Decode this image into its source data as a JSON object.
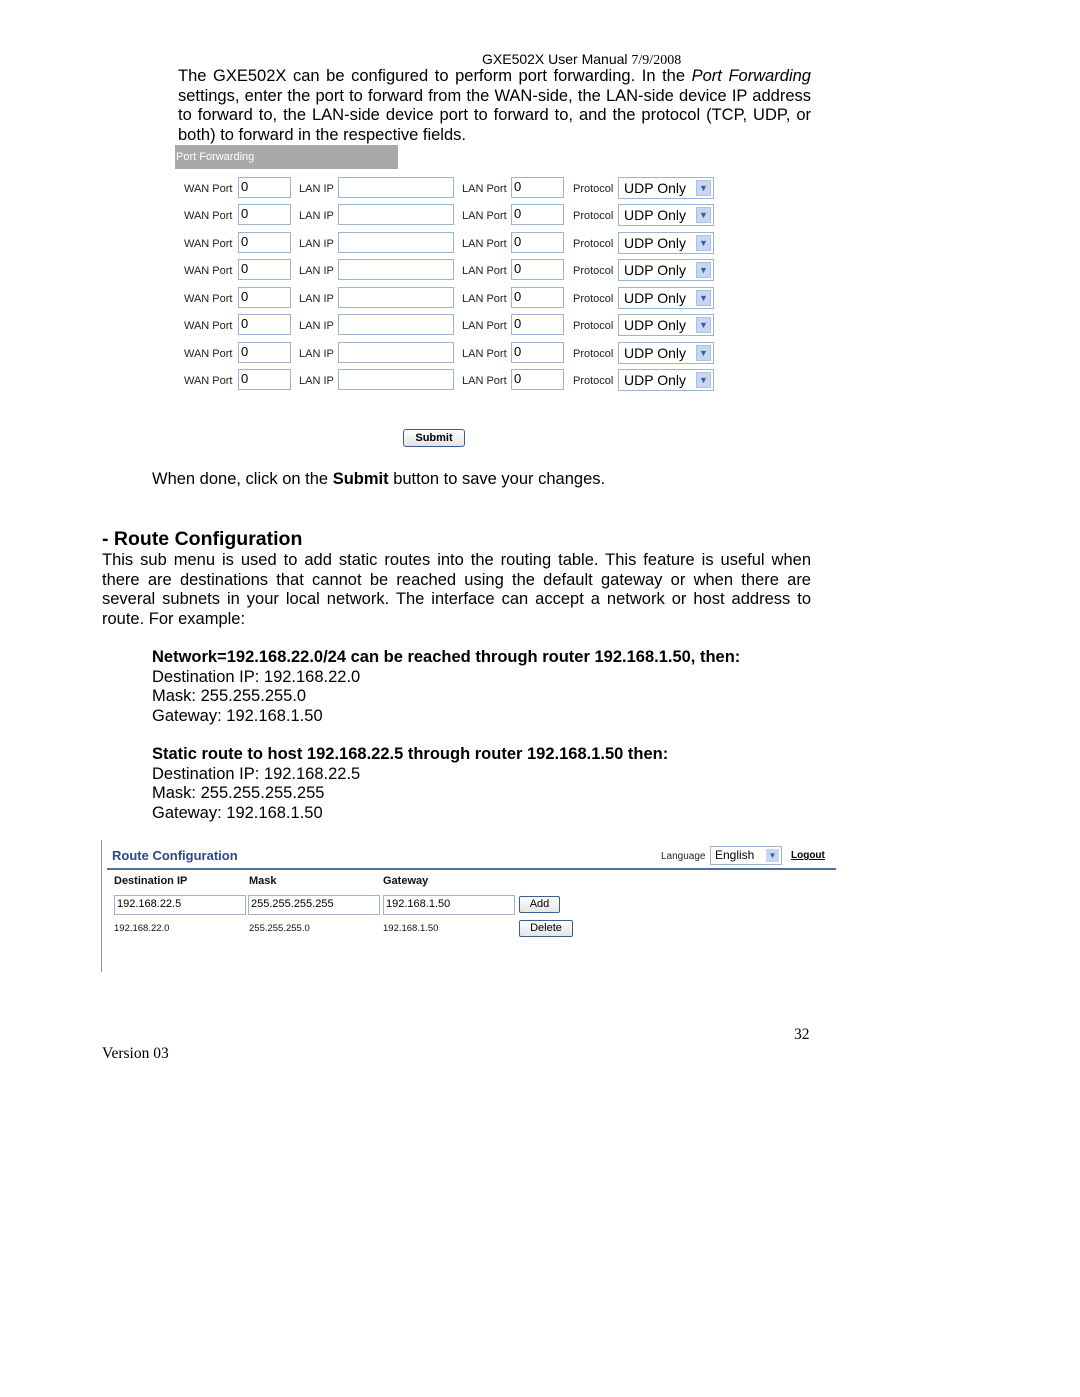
{
  "header": {
    "title": "GXE502X User Manual",
    "date": "7/9/2008"
  },
  "intro": {
    "before_italic": "The GXE502X can be configured to perform port forwarding. In the ",
    "italic": "Port Forwarding",
    "after_italic": " settings, enter the port to forward from the WAN-side, the LAN-side device IP address to forward to, the LAN-side device port to forward to, and the protocol (TCP, UDP, or both) to forward in the respective fields."
  },
  "port_forwarding": {
    "title": "Port Forwarding",
    "labels": {
      "wan_port": "WAN Port",
      "lan_ip": "LAN IP",
      "lan_port": "LAN Port",
      "protocol": "Protocol"
    },
    "rows": [
      {
        "wan_port": "0",
        "lan_ip": "",
        "lan_port": "0",
        "protocol": "UDP Only"
      },
      {
        "wan_port": "0",
        "lan_ip": "",
        "lan_port": "0",
        "protocol": "UDP Only"
      },
      {
        "wan_port": "0",
        "lan_ip": "",
        "lan_port": "0",
        "protocol": "UDP Only"
      },
      {
        "wan_port": "0",
        "lan_ip": "",
        "lan_port": "0",
        "protocol": "UDP Only"
      },
      {
        "wan_port": "0",
        "lan_ip": "",
        "lan_port": "0",
        "protocol": "UDP Only"
      },
      {
        "wan_port": "0",
        "lan_ip": "",
        "lan_port": "0",
        "protocol": "UDP Only"
      },
      {
        "wan_port": "0",
        "lan_ip": "",
        "lan_port": "0",
        "protocol": "UDP Only"
      },
      {
        "wan_port": "0",
        "lan_ip": "",
        "lan_port": "0",
        "protocol": "UDP Only"
      }
    ],
    "submit_label": "Submit"
  },
  "done_text": {
    "before": "When done, click on the ",
    "bold": "Submit",
    "after": " button to save your changes."
  },
  "route_section": {
    "heading": "- Route Configuration",
    "body": "This sub menu is used to add static routes into the routing table. This feature is useful when there are destinations that cannot be reached using the default gateway or when there are several subnets in your local network. The interface can accept a network or host address to route. For example:",
    "examples": [
      {
        "title": "Network=192.168.22.0/24 can be reached through router 192.168.1.50, then:",
        "lines": [
          "Destination IP: 192.168.22.0",
          "Mask: 255.255.255.0",
          "Gateway: 192.168.1.50"
        ]
      },
      {
        "title": "Static route to host 192.168.22.5 through router 192.168.1.50 then:",
        "lines": [
          "Destination IP: 192.168.22.5",
          "Mask: 255.255.255.255",
          "Gateway: 192.168.1.50"
        ]
      }
    ]
  },
  "route_ui": {
    "title": "Route Configuration",
    "language_label": "Language",
    "language_value": "English",
    "logout_label": "Logout",
    "columns": [
      "Destination IP",
      "Mask",
      "Gateway"
    ],
    "input": {
      "destination_ip": "192.168.22.5",
      "mask": "255.255.255.255",
      "gateway": "192.168.1.50"
    },
    "add_label": "Add",
    "routes": [
      {
        "destination_ip": "192.168.22.0",
        "mask": "255.255.255.0",
        "gateway": "192.168.1.50"
      }
    ],
    "delete_label": "Delete"
  },
  "footer": {
    "page_number": "32",
    "version": "Version 03"
  }
}
